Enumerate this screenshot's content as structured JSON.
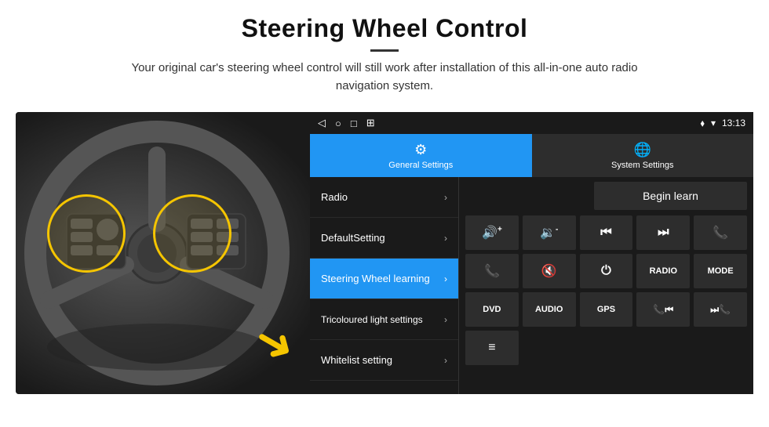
{
  "header": {
    "title": "Steering Wheel Control",
    "divider": true,
    "description": "Your original car's steering wheel control will still work after installation of this all-in-one auto radio navigation system."
  },
  "status_bar": {
    "time": "13:13",
    "icons_left": [
      "◁",
      "○",
      "□",
      "⊠"
    ],
    "icons_right": [
      "⬧",
      "▾",
      "13:13"
    ]
  },
  "tabs": [
    {
      "label": "General Settings",
      "active": true,
      "icon": "⚙"
    },
    {
      "label": "System Settings",
      "active": false,
      "icon": "🌐"
    }
  ],
  "menu_items": [
    {
      "label": "Radio",
      "active": false
    },
    {
      "label": "DefaultSetting",
      "active": false
    },
    {
      "label": "Steering Wheel learning",
      "active": true
    },
    {
      "label": "Tricoloured light settings",
      "active": false
    },
    {
      "label": "Whitelist setting",
      "active": false
    }
  ],
  "controls": {
    "begin_learn_label": "Begin learn",
    "row1": [
      "🔊+",
      "🔊-",
      "⏮",
      "⏭",
      "📞"
    ],
    "row2": [
      "📞",
      "🔇",
      "⏻",
      "RADIO",
      "MODE"
    ],
    "row3": [
      "DVD",
      "AUDIO",
      "GPS",
      "📞⏮",
      "⏭📞"
    ],
    "row4_icon": "≡"
  }
}
